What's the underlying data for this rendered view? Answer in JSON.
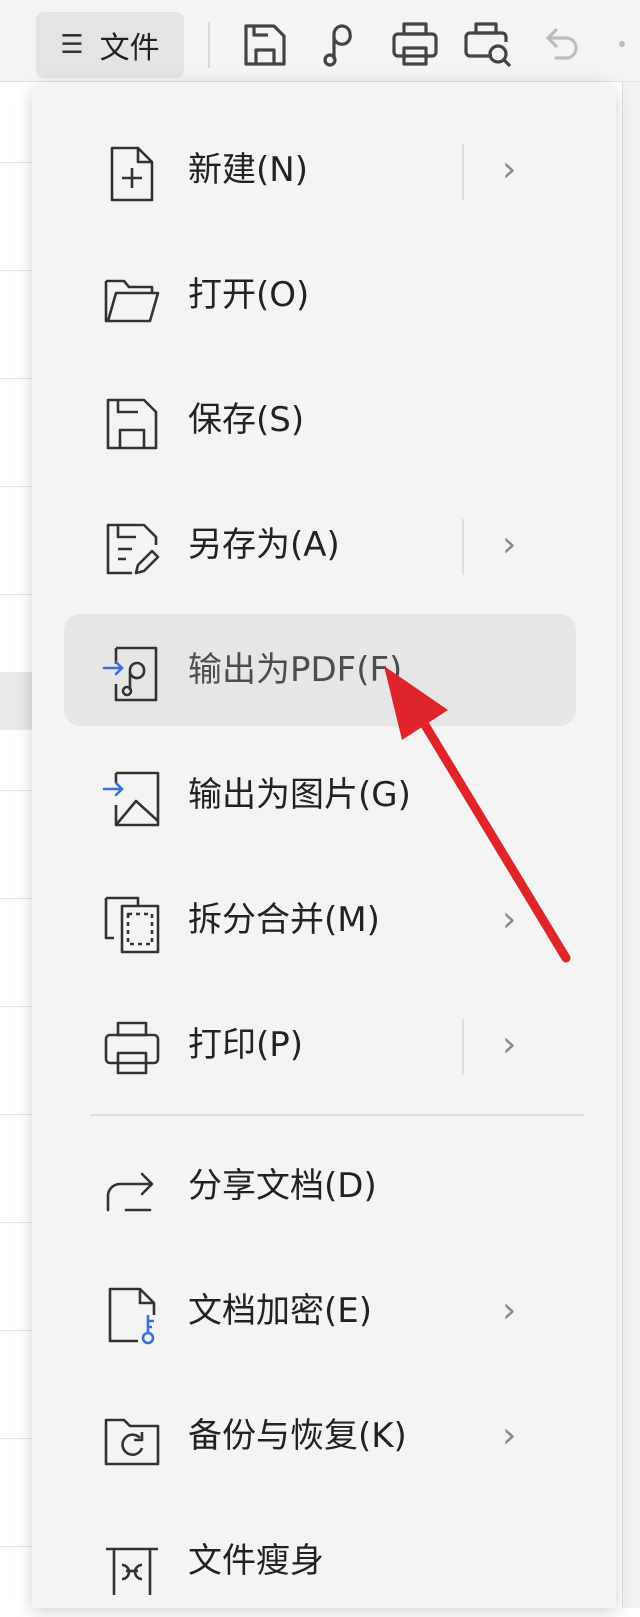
{
  "toolbar": {
    "file_button": "文件",
    "icons": [
      "menu-icon",
      "save-icon",
      "export-pdf-icon",
      "print-icon",
      "print-preview-icon",
      "undo-icon"
    ]
  },
  "menu": {
    "items": [
      {
        "label": "新建(N)",
        "icon": "new-file-icon",
        "submenu": true
      },
      {
        "label": "打开(O)",
        "icon": "folder-icon",
        "submenu": false
      },
      {
        "label": "保存(S)",
        "icon": "save-icon",
        "submenu": false
      },
      {
        "label": "另存为(A)",
        "icon": "save-as-icon",
        "submenu": true
      },
      {
        "label": "输出为PDF(F)",
        "icon": "export-pdf-icon",
        "submenu": false,
        "active": true
      },
      {
        "label": "输出为图片(G)",
        "icon": "export-image-icon",
        "submenu": false
      },
      {
        "label": "拆分合并(M)",
        "icon": "split-merge-icon",
        "submenu": true
      },
      {
        "label": "打印(P)",
        "icon": "print-icon",
        "submenu": true
      },
      {
        "label": "分享文档(D)",
        "icon": "share-icon",
        "submenu": false
      },
      {
        "label": "文档加密(E)",
        "icon": "encrypt-icon",
        "submenu": true
      },
      {
        "label": "备份与恢复(K)",
        "icon": "backup-icon",
        "submenu": true
      },
      {
        "label": "文件瘦身",
        "icon": "slim-icon",
        "submenu": false
      }
    ]
  },
  "colors": {
    "accent_blue": "#3a6fd8",
    "annotation_red": "#e0252a",
    "menu_bg": "#f4f4f4",
    "active_bg": "#e6e6e6"
  }
}
